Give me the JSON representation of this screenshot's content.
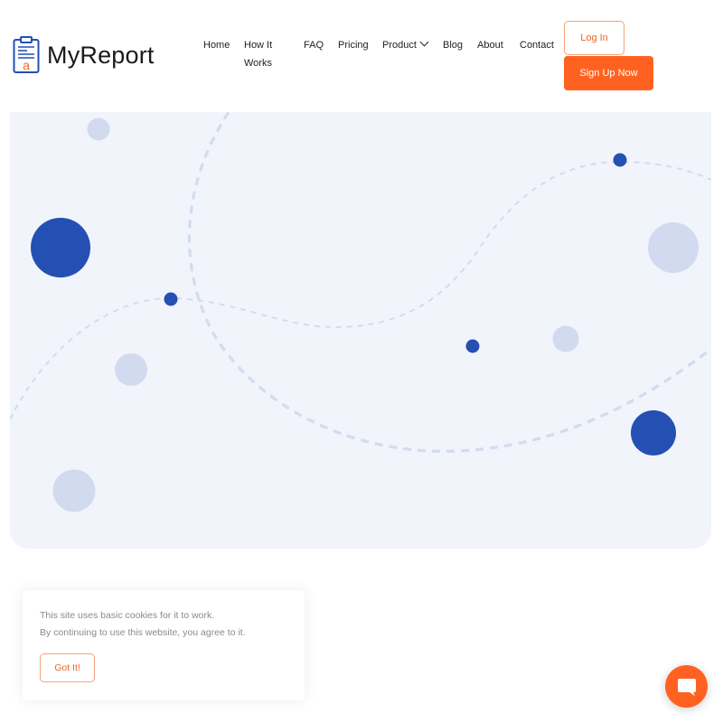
{
  "brand": {
    "name": "MyReport",
    "logo_icon": "clipboard-icon",
    "logo_letter": "a"
  },
  "nav": {
    "items": [
      {
        "label": "Home"
      },
      {
        "label_line1": "How It",
        "label_line2": "Works"
      },
      {
        "label": "FAQ"
      },
      {
        "label": "Pricing"
      },
      {
        "label": "Product",
        "icon": "chevron-down-icon"
      },
      {
        "label": "Blog"
      },
      {
        "label": "About"
      },
      {
        "label": "Contact"
      }
    ],
    "login_label": "Log In",
    "signup_label": "Sign Up Now"
  },
  "cookie_banner": {
    "line1": "This site uses basic cookies for it to work.",
    "line2": "By continuing to use this website, you agree to it.",
    "button_label": "Got It!"
  },
  "chat": {
    "icon": "chat-bubble-icon"
  },
  "colors": {
    "accent_orange": "#ff6220",
    "brand_blue": "#2450b3",
    "light_dot": "#d2daef",
    "hero_bg": "#f1f4fb"
  }
}
